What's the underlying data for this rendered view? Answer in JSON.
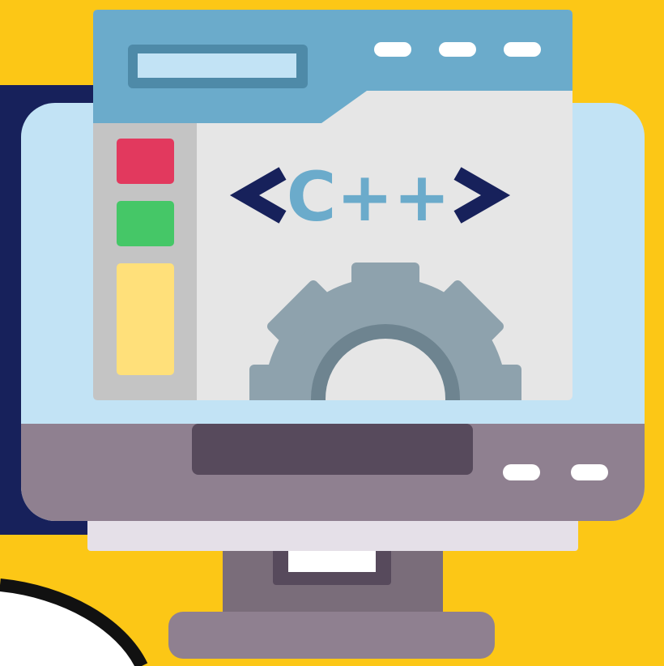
{
  "illustration": {
    "subject": "computer-monitor",
    "code_label": "C++",
    "icons": [
      "monitor-icon",
      "browser-window-icon",
      "gear-icon"
    ]
  },
  "colors": {
    "background": "#FCC716",
    "navy": "#17215B",
    "screen_light_blue": "#C2E3F5",
    "titlebar_blue": "#6BABCB",
    "address_bar_fill": "#C2E3F5",
    "address_bar_border": "#4E8AA8",
    "content_bg": "#E6E6E6",
    "sidebar_gray": "#C4C4C4",
    "red_block": "#E2395E",
    "green_block": "#45C767",
    "yellow_block": "#FFE07A",
    "gear_gray": "#8EA2AD",
    "gear_dark": "#6E8490",
    "bezel_purple": "#8F8090",
    "slot_dark": "#574A5C",
    "stand_gray": "#7A6D7A",
    "stand_light": "#E5E0E8",
    "white": "#FFFFFF"
  }
}
